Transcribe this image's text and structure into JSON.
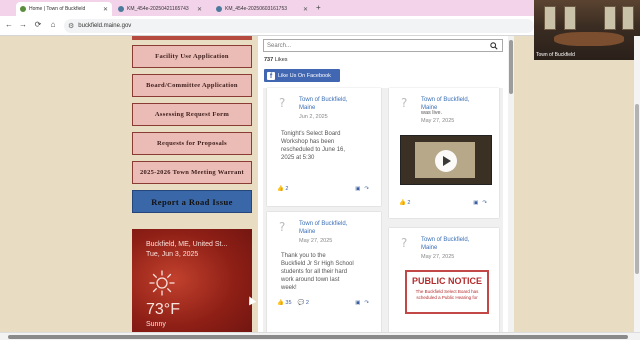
{
  "browser": {
    "tabs": [
      {
        "title": "Home | Town of Buckfield",
        "active": true
      },
      {
        "title": "KM_454e-20250421165743",
        "active": false
      },
      {
        "title": "KM_454e-20250603161753",
        "active": false
      }
    ],
    "new_tab": "+",
    "nav": {
      "back": "←",
      "forward": "→",
      "reload": "⟳",
      "home": "⌂"
    },
    "url": "buckfield.maine.gov"
  },
  "webcam": {
    "label": "Town of Buckfield"
  },
  "sidebar": {
    "buttons": [
      "Facility Use Application",
      "Board/Committee Application",
      "Assessing Request Form",
      "Requests for Proposals",
      "2025-2026 Town Meeting Warrant"
    ],
    "road_issue": "Report a Road Issue",
    "weather": {
      "location": "Buckfield, ME, United St...",
      "date": "Tue, Jun 3, 2025",
      "temp": "73°F",
      "condition": "Sunny"
    }
  },
  "main": {
    "search_placeholder": "Search...",
    "likes_count": "737",
    "likes_word": "Likes",
    "fb_button": "Like Us On Facebook",
    "posts": [
      {
        "name_line1": "Town of Buckfield,",
        "name_line2": "Maine",
        "date": "Jun 2, 2025",
        "body": [
          "Tonight's Select Board",
          "Workshop has been",
          "rescheduled to June 16,",
          "2025 at 5:30"
        ],
        "likes": "2"
      },
      {
        "name_line1": "Town of Buckfield,",
        "name_line2": "Maine",
        "status": "was live.",
        "date": "May 27, 2025",
        "likes": "2"
      },
      {
        "name_line1": "Town of Buckfield,",
        "name_line2": "Maine",
        "date": "May 27, 2025",
        "body": [
          "Thank you to the",
          "Buckfield Jr Sr High School",
          "students for all their hard",
          "work around town last",
          "week!"
        ],
        "likes": "35",
        "comments": "2"
      },
      {
        "name_line1": "Town of Buckfield,",
        "name_line2": "Maine",
        "date": "May 27, 2025",
        "notice_title": "PUBLIC NOTICE",
        "notice_text": "The Buckfield Select Board has scheduled a Public Hearing for"
      }
    ]
  },
  "colors": {
    "page_bg": "#e8dcc2",
    "sidebar_button": "#ebbcb6",
    "road_button": "#3a67a8",
    "facebook": "#4267b2",
    "link": "#3b6fb6",
    "notice_red": "#b52c2c"
  }
}
